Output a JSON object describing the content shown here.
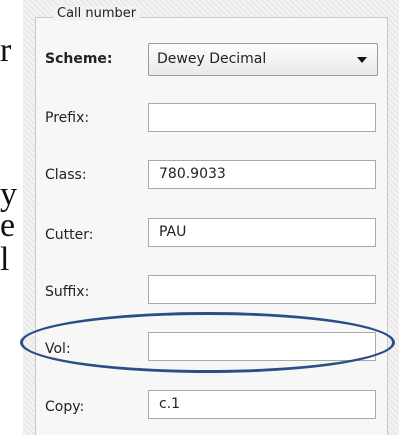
{
  "background_text": {
    "r": "r",
    "y": "y",
    "e": "e",
    "l": "l"
  },
  "call_number": {
    "title": "Call number",
    "scheme": {
      "label": "Scheme:",
      "value": "Dewey Decimal"
    },
    "prefix": {
      "label": "Prefix:",
      "value": ""
    },
    "class": {
      "label": "Class:",
      "value": "780.9033"
    },
    "cutter": {
      "label": "Cutter:",
      "value": "PAU"
    },
    "suffix": {
      "label": "Suffix:",
      "value": ""
    },
    "vol": {
      "label": "Vol:",
      "value": ""
    },
    "copy": {
      "label": "Copy:",
      "value": "c.1"
    }
  },
  "colors": {
    "highlight_ellipse": "#2a4f86"
  }
}
